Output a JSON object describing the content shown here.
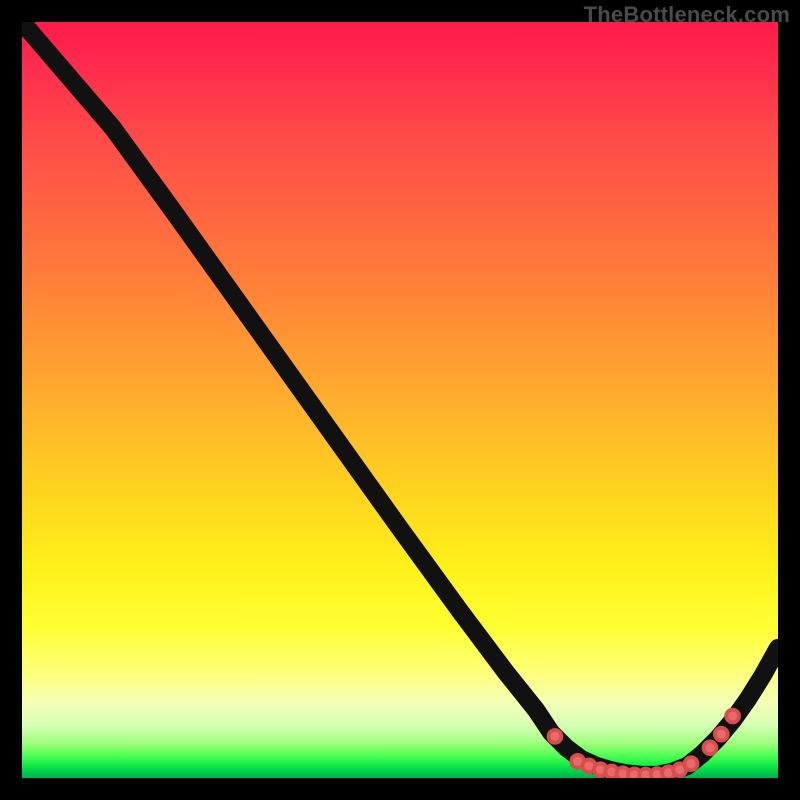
{
  "watermark": "TheBottleneck.com",
  "colors": {
    "point_fill": "#e86a6a",
    "point_stroke": "#d84e4e",
    "curve": "#111111",
    "frame": "#000000"
  },
  "chart_data": {
    "type": "line",
    "title": "",
    "xlabel": "",
    "ylabel": "",
    "xlim": [
      0,
      100
    ],
    "ylim": [
      0,
      100
    ],
    "grid": false,
    "legend": false,
    "annotations": [
      "TheBottleneck.com"
    ],
    "series": [
      {
        "name": "curve",
        "x": [
          0,
          6,
          12,
          20,
          30,
          40,
          50,
          58,
          64,
          68,
          70,
          72,
          74,
          76,
          78,
          80,
          82,
          84,
          86,
          88,
          90,
          92,
          94,
          96,
          98,
          100
        ],
        "y": [
          100,
          93,
          86,
          75,
          61,
          47,
          33,
          22,
          14,
          9,
          6,
          4,
          2.5,
          1.6,
          1.0,
          0.6,
          0.4,
          0.4,
          0.8,
          1.6,
          3.2,
          5.2,
          7.6,
          10.4,
          13.6,
          17.2
        ]
      }
    ],
    "highlight_points": {
      "comment": "salmon dots along the valley and right rise",
      "x": [
        70.5,
        73.5,
        75,
        76.5,
        78,
        79.5,
        81,
        82.5,
        84,
        85.5,
        87,
        88.5,
        91,
        92.5,
        94
      ],
      "y": [
        5.5,
        2.2,
        1.6,
        1.1,
        0.8,
        0.55,
        0.42,
        0.4,
        0.45,
        0.7,
        1.1,
        1.9,
        4.0,
        5.8,
        8.2
      ]
    }
  }
}
